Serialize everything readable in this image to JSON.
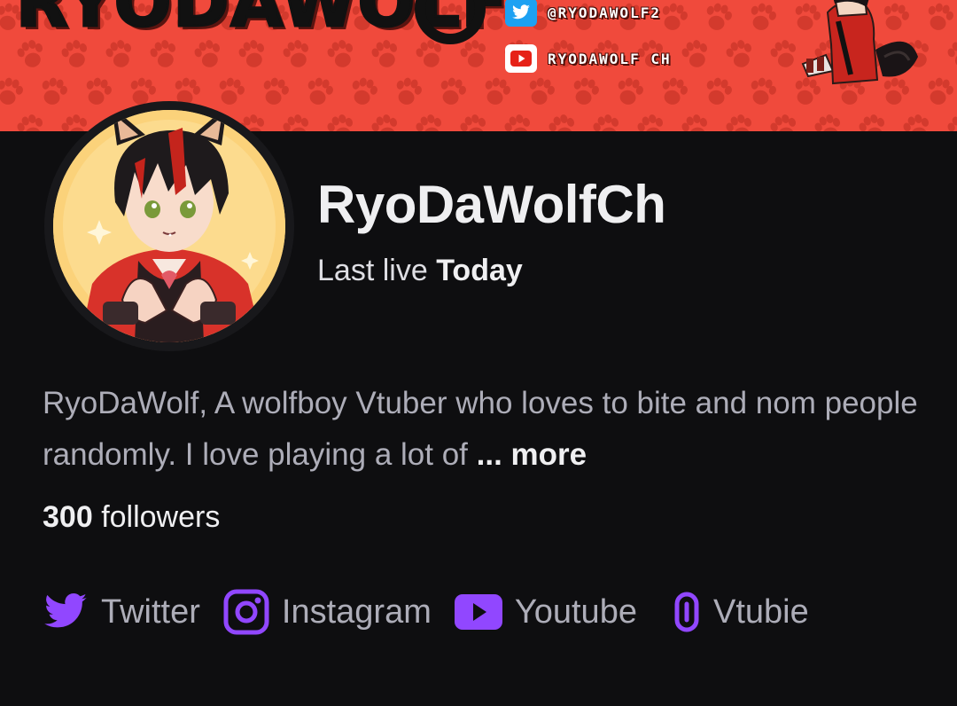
{
  "banner": {
    "title": "RYODAWOLF",
    "socials": [
      {
        "platform": "twitter",
        "handle": "@RYODAWOLF2",
        "icon": "twitter-icon"
      },
      {
        "platform": "youtube",
        "handle": "RYODAWOLF CH",
        "icon": "youtube-icon"
      }
    ],
    "colors": {
      "background": "#f04a3c",
      "paw": "#d33a2d"
    }
  },
  "profile": {
    "channel_name": "RyoDaWolfCh",
    "last_live_prefix": "Last live",
    "last_live_value": "Today",
    "bio_text": "RyoDaWolf, A wolfboy Vtuber who loves to bite and nom people randomly. I love playing a lot of",
    "bio_more": "... more",
    "followers_count": "300",
    "followers_label": "followers"
  },
  "links": [
    {
      "label": "Twitter",
      "icon": "twitter-icon"
    },
    {
      "label": "Instagram",
      "icon": "instagram-icon"
    },
    {
      "label": "Youtube",
      "icon": "youtube-icon"
    },
    {
      "label": "Vtubie",
      "icon": "link-icon"
    }
  ],
  "colors": {
    "background": "#0e0e10",
    "accent": "#9147ff",
    "text_primary": "#efeff1",
    "text_secondary": "#adadb8"
  }
}
